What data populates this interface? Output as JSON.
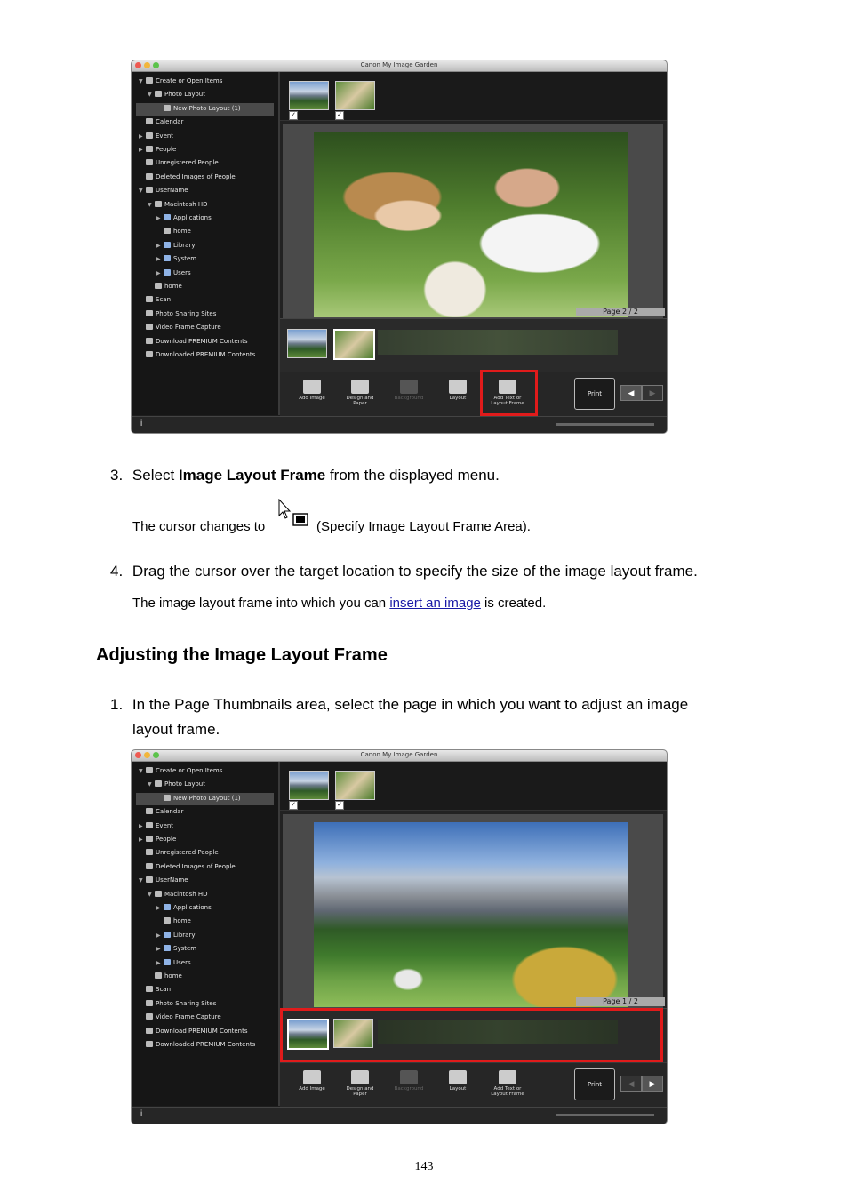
{
  "app": {
    "window_title": "Canon My Image Garden",
    "sidebar": [
      {
        "label": "Create or Open Items",
        "level": 0,
        "arrow": "▼"
      },
      {
        "label": "Photo Layout",
        "level": 1,
        "arrow": "▼"
      },
      {
        "label": "New Photo Layout (1)",
        "level": 2,
        "arrow": "",
        "selected": true
      },
      {
        "label": "Calendar",
        "level": 0,
        "arrow": ""
      },
      {
        "label": "Event",
        "level": 0,
        "arrow": "▶"
      },
      {
        "label": "People",
        "level": 0,
        "arrow": "▶"
      },
      {
        "label": "Unregistered People",
        "level": 0,
        "arrow": ""
      },
      {
        "label": "Deleted Images of People",
        "level": 0,
        "arrow": ""
      },
      {
        "label": "UserName",
        "level": 0,
        "arrow": "▼"
      },
      {
        "label": "Macintosh HD",
        "level": 1,
        "arrow": "▼"
      },
      {
        "label": "Applications",
        "level": 2,
        "arrow": "▶",
        "folder": true
      },
      {
        "label": "home",
        "level": 2,
        "arrow": ""
      },
      {
        "label": "Library",
        "level": 2,
        "arrow": "▶",
        "folder": true
      },
      {
        "label": "System",
        "level": 2,
        "arrow": "▶",
        "folder": true
      },
      {
        "label": "Users",
        "level": 2,
        "arrow": "▶",
        "folder": true
      },
      {
        "label": "home",
        "level": 1,
        "arrow": ""
      },
      {
        "label": "Scan",
        "level": 0,
        "arrow": ""
      },
      {
        "label": "Photo Sharing Sites",
        "level": 0,
        "arrow": ""
      },
      {
        "label": "Video Frame Capture",
        "level": 0,
        "arrow": ""
      },
      {
        "label": "Download PREMIUM Contents",
        "level": 0,
        "arrow": ""
      },
      {
        "label": "Downloaded PREMIUM Contents",
        "level": 0,
        "arrow": ""
      }
    ],
    "toolbar": {
      "add_image": "Add Image",
      "design_paper": "Design and Paper",
      "background": "Background",
      "layout": "Layout",
      "add_text": "Add Text or Layout Frame",
      "print": "Print"
    },
    "check_mark": "✓",
    "status_info": "i"
  },
  "screenshot1": {
    "page_label": "Page 2 / 2"
  },
  "screenshot2": {
    "page_label": "Page 1 / 2"
  },
  "doc": {
    "step3_num": "3.",
    "step3_pre": "Select ",
    "step3_bold": "Image Layout Frame",
    "step3_post": " from the displayed menu.",
    "cursor_pre": "The cursor changes to",
    "cursor_post": "(Specify Image Layout Frame Area).",
    "step4_num": "4.",
    "step4_text": "Drag the cursor over the target location to specify the size of the image layout frame.",
    "step4_note_pre": "The image layout frame into which you can ",
    "step4_note_link": "insert an image",
    "step4_note_post": " is created.",
    "heading": "Adjusting the Image Layout Frame",
    "step1_num": "1.",
    "step1_line1": "In the Page Thumbnails area, select the page in which you want to adjust an image",
    "step1_line2": "layout frame."
  },
  "page_number": "143",
  "colors": {
    "highlight_red": "#e01b1b",
    "link_blue": "#1a1aa6"
  }
}
